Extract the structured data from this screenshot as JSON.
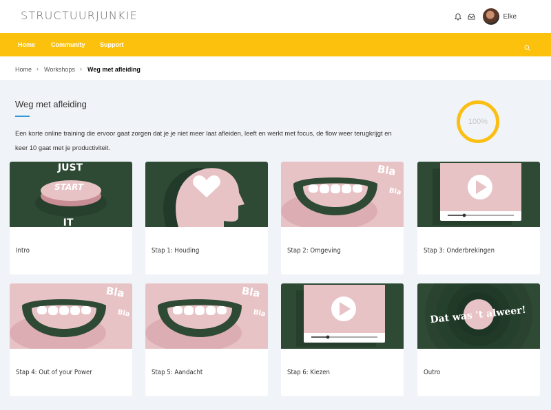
{
  "header": {
    "logo": "STRUCTUURJUNKIE",
    "icons": [
      "bell-icon",
      "inbox-icon"
    ],
    "username": "Elke"
  },
  "nav": {
    "items": [
      {
        "label": "Home"
      },
      {
        "label": "Community"
      },
      {
        "label": "Support"
      }
    ],
    "search_icon": "search-icon"
  },
  "breadcrumb": {
    "items": [
      "Home",
      "Workshops",
      "Weg met afleiding"
    ],
    "separator": "›"
  },
  "course": {
    "title": "Weg met afleiding",
    "description": "Een korte online training die ervoor gaat zorgen dat je je niet meer laat afleiden, leeft en werkt met focus, de flow weer terugkrijgt en keer 10 gaat met je productiviteit.",
    "progress_label": "100%",
    "progress_value": 100
  },
  "colors": {
    "brand": "#fcc10d",
    "accent_line": "#2f9ad6",
    "dark_green": "#2e4a35",
    "pink": "#e8c3c6"
  },
  "lessons": [
    {
      "label": "Intro",
      "thumb": "just-start-it",
      "thumb_text": [
        "JUST",
        "START",
        "IT"
      ]
    },
    {
      "label": "Stap 1: Houding",
      "thumb": "head-heart"
    },
    {
      "label": "Stap 2: Omgeving",
      "thumb": "mouth-bla",
      "thumb_text": [
        "Bla",
        "Bla"
      ]
    },
    {
      "label": "Stap 3: Onderbrekingen",
      "thumb": "video-player"
    },
    {
      "label": "Stap 4: Out of your Power",
      "thumb": "mouth-bla",
      "thumb_text": [
        "Bla",
        "Bla"
      ]
    },
    {
      "label": "Stap 5: Aandacht",
      "thumb": "mouth-bla",
      "thumb_text": [
        "Bla",
        "Bla"
      ]
    },
    {
      "label": "Stap 6: Kiezen",
      "thumb": "video-player"
    },
    {
      "label": "Outro",
      "thumb": "dat-was-t-alweer",
      "thumb_text": [
        "Dat was 't alweer!"
      ]
    }
  ]
}
